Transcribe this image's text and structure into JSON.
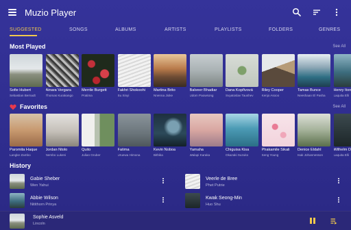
{
  "app": {
    "title": "Muzio Player",
    "icons": [
      "menu-icon",
      "search-icon",
      "sort-icon",
      "more-vert-icon"
    ]
  },
  "tabs": [
    {
      "label": "SUGGESTED",
      "active": true
    },
    {
      "label": "SONGS"
    },
    {
      "label": "ALBUMS"
    },
    {
      "label": "ARTISTS"
    },
    {
      "label": "PLAYLISTS"
    },
    {
      "label": "FOLDERS"
    },
    {
      "label": "GENRES"
    }
  ],
  "most_played": {
    "title": "Most Played",
    "see_all": "See All",
    "items": [
      {
        "title": "Sofie Hubert",
        "subtitle": "Sebastian Bernadt",
        "art": "farmhouse"
      },
      {
        "title": "Ainara Vergara",
        "subtitle": "Thomas Kurakango",
        "art": "city"
      },
      {
        "title": "Merrile Burgett",
        "subtitle": "Pratima",
        "art": "flowers"
      },
      {
        "title": "Fakhri Shokoohi",
        "subtitle": "Su Xinyi",
        "art": "white-wave"
      },
      {
        "title": "Martina Brito",
        "subtitle": "Nnenna Jioke",
        "art": "canyon"
      },
      {
        "title": "Balveer Bhadiar",
        "subtitle": "Udom Paowsong",
        "art": "fog-hills"
      },
      {
        "title": "Dana Kopřivová",
        "subtitle": "Svyatoslav Taushev",
        "art": "plant"
      },
      {
        "title": "Riley Cooper",
        "subtitle": "Kenjo Asooo",
        "art": "mountain"
      },
      {
        "title": "Tamas Bunce",
        "subtitle": "Neeshaan El Pasha",
        "art": "lake"
      },
      {
        "title": "Henry Iton",
        "subtitle": "Laquita Elli",
        "art": "coast"
      }
    ]
  },
  "favorites": {
    "title": "Favorites",
    "see_all": "See All",
    "items": [
      {
        "title": "Paromita Haque",
        "subtitle": "Langke Zambo",
        "art": "desert"
      },
      {
        "title": "Jordan Ntolo",
        "subtitle": "Nembo Lukeni",
        "art": "fog-hill"
      },
      {
        "title": "Quito",
        "subtitle": "Julian Gruber",
        "art": "trees"
      },
      {
        "title": "Fatima",
        "subtitle": "Uruewa Himona",
        "art": "gray-sky"
      },
      {
        "title": "Kevin Noboa",
        "subtitle": "Bithika",
        "art": "night-sky"
      },
      {
        "title": "Yamaha",
        "subtitle": "Walapi Karaka",
        "art": "peach-sky"
      },
      {
        "title": "Chiguisa Kisa",
        "subtitle": "Okazaki Suzuko",
        "art": "teal-lake"
      },
      {
        "title": "Phakamile Sikali",
        "subtitle": "Seng Young",
        "art": "blossom"
      },
      {
        "title": "Denice Eldahl",
        "subtitle": "Isak Johannesson",
        "art": "green-field"
      },
      {
        "title": "Wilhelm D",
        "subtitle": "Laquita Elli",
        "art": "dark-forest"
      }
    ]
  },
  "history": {
    "title": "History",
    "items": [
      {
        "title": "Gabie Sheber",
        "subtitle": "Wen Yahui",
        "art": "farmhouse"
      },
      {
        "title": "Veerle de Bree",
        "subtitle": "Phet Putrie",
        "art": "white-wave"
      },
      {
        "title": "Abbie Wilson",
        "subtitle": "Nitithorn Prinya",
        "art": "coast"
      },
      {
        "title": "Kwak Seong-Min",
        "subtitle": "Huo Shu",
        "art": "dark-forest"
      }
    ]
  },
  "now_playing": {
    "title": "Sophie Asveld",
    "subtitle": "Lincoln",
    "art": "farmhouse",
    "state": "playing"
  },
  "colors": {
    "background": "#2f2d8e",
    "accent": "#f2c94c",
    "favorite": "#e8394d",
    "secondary_text": "#b9b9dc"
  }
}
